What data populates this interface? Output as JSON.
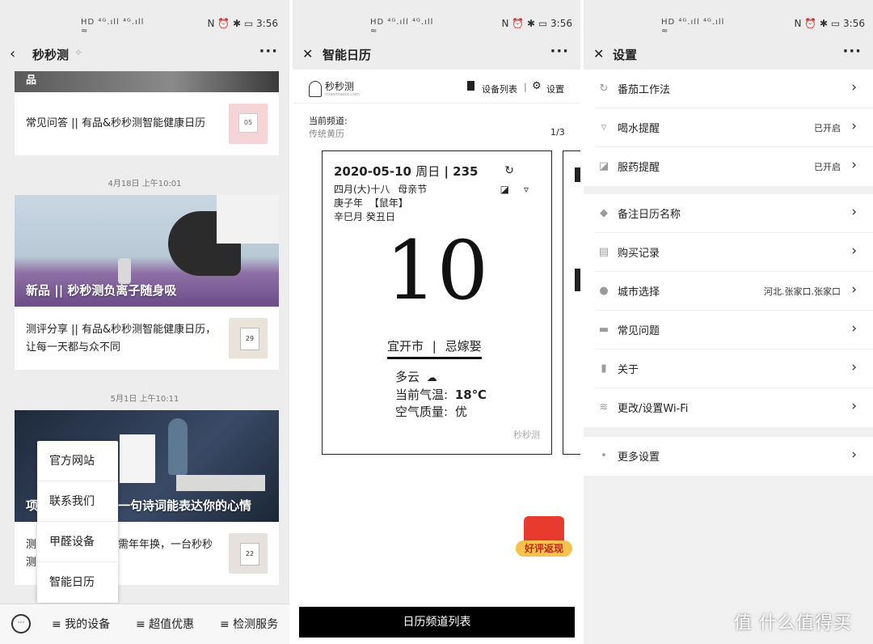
{
  "status": {
    "indicators": "HD ⁴ᴳ.ıll ⁴ᴳ.ıll ≈",
    "icons_right": "N ⏰ ✱ ▭",
    "time": "3:56"
  },
  "panel1": {
    "title": "秒秒测",
    "more": "···",
    "top_caption": "品",
    "card1_text": "常见问答 || 有品&秒秒测智能健康日历",
    "thumb1_text": "05",
    "time1": "4月18日 上午10:01",
    "card2_caption": "新品 || 秒秒测负离子随身吸",
    "card2_text_line1": "测评分享 || 有品&秒秒测智能健康日历，",
    "card2_text_line2": "让每一天都与众不同",
    "thumb2_text": "29",
    "time2": "5月1日 上午10:11",
    "card3_caption": "项",
    "card3_caption_tail": "一句诗词能表达你的心情",
    "card3_text_a": "测",
    "card3_text_b": "需年年换，一台秒秒",
    "card3_text_c": "测",
    "thumb3_text": "22",
    "menu": [
      "官方网站",
      "联系我们",
      "甲醛设备",
      "智能日历"
    ],
    "tabs": [
      "≡ 我的设备",
      "≡ 超值优惠",
      "≡ 检测服务"
    ],
    "keyboard_icon": "⋯"
  },
  "panel2": {
    "title": "智能日历",
    "close": "✕",
    "more": "···",
    "brand": "秒秒测",
    "brand_url": "miaomiaoce.com",
    "device_list": "设备列表",
    "divider": "|",
    "settings": "设置",
    "current_channel_label": "当前频道:",
    "current_channel": "传统黄历",
    "pager": "1/3",
    "cal": {
      "date": "2020-05-10",
      "weekday": "周日",
      "bar": "|",
      "daynum": "235",
      "lunar": "四月(大)十八",
      "festival": "母亲节",
      "year": "庚子年",
      "zodiac": "【鼠年】",
      "ganzhi": "辛巳月  癸丑日",
      "big_day": "10",
      "suitable": "宜开市",
      "sep": "|",
      "avoid": "忌嫁娶",
      "weather": "多云",
      "temp_label": "当前气温:",
      "temp": "18℃",
      "air_label": "空气质量:",
      "air": "优",
      "watermark": "秒秒测"
    },
    "promo": "好评返现",
    "bottom_button": "日历频道列表"
  },
  "panel3": {
    "title": "设置",
    "close": "✕",
    "more": "···",
    "group1": [
      {
        "icon": "timer-icon",
        "label": "番茄工作法",
        "value": ""
      },
      {
        "icon": "cup-icon",
        "label": "喝水提醒",
        "value": "已开启"
      },
      {
        "icon": "pill-icon",
        "label": "服药提醒",
        "value": "已开启"
      }
    ],
    "group2": [
      {
        "icon": "tag-icon",
        "label": "备注日历名称",
        "value": ""
      },
      {
        "icon": "receipt-icon",
        "label": "购买记录",
        "value": ""
      },
      {
        "icon": "location-icon",
        "label": "城市选择",
        "value": "河北.张家口.张家口"
      },
      {
        "icon": "chat-icon",
        "label": "常见问题",
        "value": ""
      },
      {
        "icon": "book-icon",
        "label": "关于",
        "value": ""
      },
      {
        "icon": "wifi-icon",
        "label": "更改/设置Wi-Fi",
        "value": ""
      }
    ],
    "group3": [
      {
        "icon": "more-icon",
        "label": "更多设置",
        "value": ""
      }
    ],
    "chevron": "›"
  },
  "watermark": "值 什么值得买"
}
